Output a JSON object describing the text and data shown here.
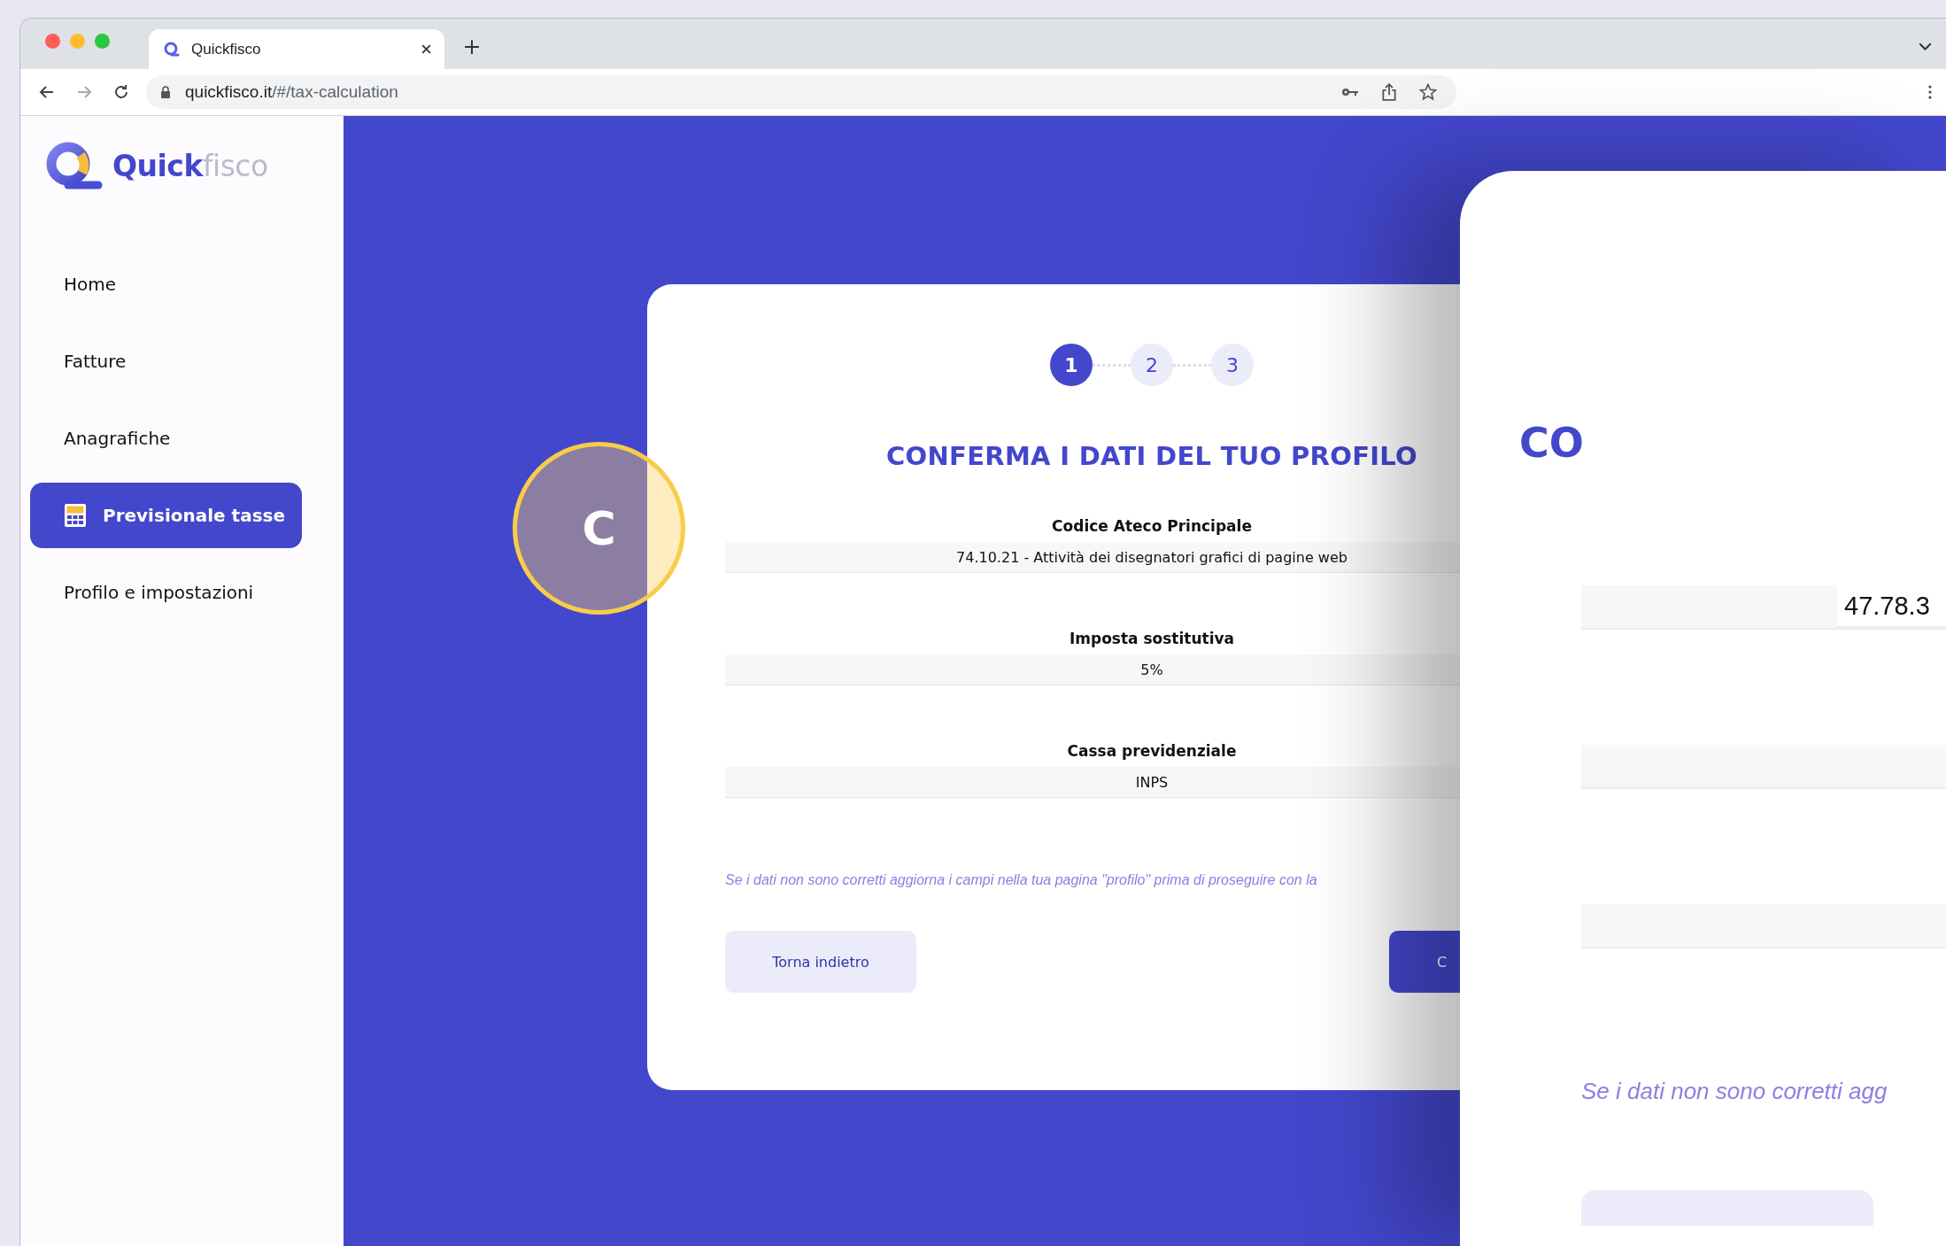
{
  "browser": {
    "tab": {
      "title": "Quickfisco"
    },
    "url": {
      "domain": "quickfisco.it",
      "path": "/#/tax-calculation"
    }
  },
  "sidebar": {
    "logo": {
      "primary": "Quick",
      "secondary": "fisco"
    },
    "items": [
      {
        "label": "Home",
        "selected": false
      },
      {
        "label": "Fatture",
        "selected": false
      },
      {
        "label": "Anagrafiche",
        "selected": false
      },
      {
        "label": "Previsionale tasse",
        "selected": true
      },
      {
        "label": "Profilo e impostazioni",
        "selected": false
      }
    ]
  },
  "marker": {
    "label": "C"
  },
  "card": {
    "steps": [
      {
        "label": "1",
        "selected": true
      },
      {
        "label": "2",
        "selected": false
      },
      {
        "label": "3",
        "selected": false
      }
    ],
    "title": "CONFERMA I DATI DEL TUO PROFILO",
    "fields": [
      {
        "label": "Codice Ateco Principale",
        "value": "74.10.21 - Attività dei disegnatori grafici di pagine web"
      },
      {
        "label": "Imposta sostitutiva",
        "value": "5%"
      },
      {
        "label": "Cassa previdenziale",
        "value": "INPS"
      }
    ],
    "note": "Se i dati non sono corretti aggiorna i campi nella tua pagina \"profilo\" prima di proseguire con la",
    "buttons": [
      {
        "label": "Torna indietro",
        "kind": "secondary"
      },
      {
        "label": "C",
        "kind": "primary"
      }
    ]
  },
  "overlay": {
    "title": "CO",
    "code_value": "47.78.3",
    "note": "Se i dati non sono corretti agg"
  }
}
